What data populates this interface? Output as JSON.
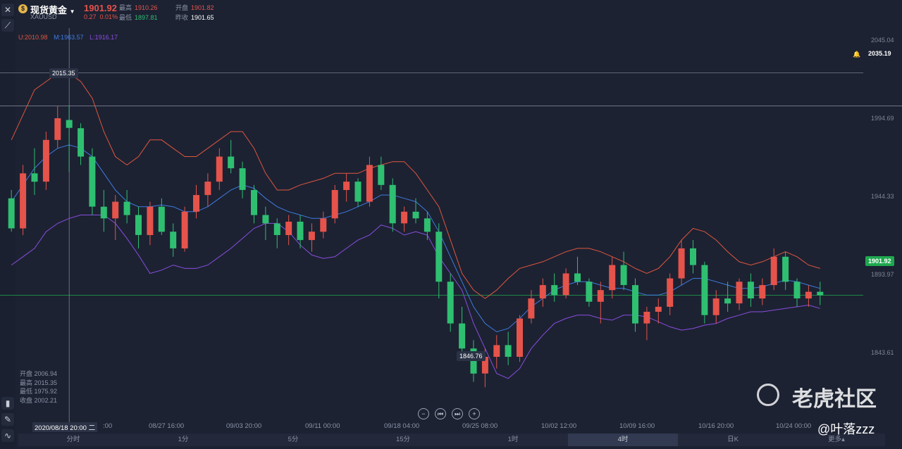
{
  "symbol": {
    "name": "现货黄金",
    "code": "XAUUSD",
    "price": "1901.92",
    "change": "0.27",
    "change_pct": "0.01%",
    "high_label": "最高",
    "high": "1910.26",
    "open_label": "开盘",
    "open": "1901.82",
    "low_label": "最低",
    "low": "1897.81",
    "prev_label": "昨收",
    "prev": "1901.65"
  },
  "boll": {
    "u": "U:2010.98",
    "m": "M:1963.57",
    "l": "L:1916.17"
  },
  "y_axis": [
    "2045.04",
    "1994.69",
    "1944.33",
    "1893.97",
    "1843.61"
  ],
  "markers": {
    "alert_price": "2035.19",
    "current_price": "1901.92",
    "peak": "2015.35",
    "trough": "1846.76"
  },
  "info": {
    "open": "开盘 2006.94",
    "high": "最高 2015.35",
    "low": "最低 1975.92",
    "close": "收盘 2002.21"
  },
  "crosshair_time": "2020/08/18 20:00 二",
  "x_axis": [
    "08/27 16:00",
    "09/03 20:00",
    "09/11 00:00",
    "09/18 04:00",
    "09/25 08:00",
    "10/02 12:00",
    "10/09 16:00",
    "10/16 20:00",
    "10/24 00:00"
  ],
  "x_axis_partial": ":00",
  "nav_buttons": [
    "−",
    "⏮",
    "⏭",
    "+"
  ],
  "periods": [
    "分时",
    "1分",
    "5分",
    "15分",
    "1时",
    "4时",
    "日K",
    "更多▴"
  ],
  "active_period": "4时",
  "watermark": "老虎社区",
  "credit": "@叶落zzz",
  "colors": {
    "up": "#e5534b",
    "down": "#2fbf71",
    "upper_band": "#e0563f",
    "mid_band": "#3f7be0",
    "lower_band": "#8a4de0",
    "current_tag": "#1fa84f"
  },
  "chart_data": {
    "type": "candlestick",
    "ylim": [
      1830,
      2062
    ],
    "candles": [
      [
        1960,
        1965,
        1940,
        1942
      ],
      [
        1942,
        1980,
        1938,
        1975
      ],
      [
        1975,
        1990,
        1962,
        1970
      ],
      [
        1970,
        2000,
        1965,
        1995
      ],
      [
        1995,
        2015.35,
        1990,
        2008
      ],
      [
        2006.94,
        2015.35,
        1975.92,
        2002.21
      ],
      [
        2002,
        2005,
        1980,
        1985
      ],
      [
        1985,
        1990,
        1950,
        1955
      ],
      [
        1955,
        1965,
        1940,
        1948
      ],
      [
        1948,
        1962,
        1935,
        1958
      ],
      [
        1958,
        1965,
        1945,
        1950
      ],
      [
        1950,
        1955,
        1930,
        1938
      ],
      [
        1938,
        1958,
        1932,
        1955
      ],
      [
        1955,
        1960,
        1938,
        1940
      ],
      [
        1940,
        1945,
        1925,
        1930
      ],
      [
        1930,
        1955,
        1928,
        1952
      ],
      [
        1952,
        1968,
        1948,
        1962
      ],
      [
        1962,
        1975,
        1955,
        1970
      ],
      [
        1970,
        1990,
        1965,
        1985
      ],
      [
        1985,
        1995,
        1975,
        1978
      ],
      [
        1978,
        1982,
        1960,
        1965
      ],
      [
        1965,
        1968,
        1945,
        1950
      ],
      [
        1950,
        1955,
        1935,
        1945
      ],
      [
        1945,
        1948,
        1930,
        1938
      ],
      [
        1938,
        1950,
        1932,
        1946
      ],
      [
        1946,
        1950,
        1930,
        1935
      ],
      [
        1935,
        1945,
        1928,
        1940
      ],
      [
        1940,
        1952,
        1936,
        1948
      ],
      [
        1948,
        1968,
        1945,
        1965
      ],
      [
        1965,
        1975,
        1958,
        1970
      ],
      [
        1970,
        1972,
        1955,
        1958
      ],
      [
        1958,
        1985,
        1955,
        1980
      ],
      [
        1980,
        1985,
        1965,
        1968
      ],
      [
        1968,
        1972,
        1940,
        1945
      ],
      [
        1945,
        1955,
        1940,
        1952
      ],
      [
        1952,
        1960,
        1945,
        1948
      ],
      [
        1948,
        1952,
        1935,
        1940
      ],
      [
        1940,
        1945,
        1900,
        1910
      ],
      [
        1910,
        1915,
        1880,
        1885
      ],
      [
        1885,
        1895,
        1865,
        1870
      ],
      [
        1870,
        1875,
        1850,
        1855
      ],
      [
        1855,
        1870,
        1846.76,
        1865
      ],
      [
        1865,
        1878,
        1858,
        1872
      ],
      [
        1872,
        1880,
        1860,
        1865
      ],
      [
        1865,
        1890,
        1862,
        1888
      ],
      [
        1888,
        1905,
        1885,
        1900
      ],
      [
        1900,
        1912,
        1895,
        1908
      ],
      [
        1908,
        1915,
        1898,
        1902
      ],
      [
        1902,
        1918,
        1900,
        1915
      ],
      [
        1915,
        1925,
        1908,
        1910
      ],
      [
        1910,
        1912,
        1895,
        1898
      ],
      [
        1898,
        1910,
        1885,
        1905
      ],
      [
        1905,
        1925,
        1900,
        1920
      ],
      [
        1920,
        1928,
        1905,
        1908
      ],
      [
        1908,
        1912,
        1880,
        1885
      ],
      [
        1885,
        1895,
        1875,
        1892
      ],
      [
        1892,
        1900,
        1885,
        1895
      ],
      [
        1895,
        1915,
        1890,
        1912
      ],
      [
        1912,
        1935,
        1908,
        1930
      ],
      [
        1930,
        1935,
        1915,
        1920
      ],
      [
        1920,
        1922,
        1885,
        1890
      ],
      [
        1890,
        1905,
        1885,
        1900
      ],
      [
        1900,
        1910,
        1892,
        1897
      ],
      [
        1897,
        1912,
        1893,
        1910
      ],
      [
        1910,
        1915,
        1895,
        1900
      ],
      [
        1900,
        1912,
        1896,
        1908
      ],
      [
        1908,
        1930,
        1905,
        1925
      ],
      [
        1925,
        1928,
        1905,
        1910
      ],
      [
        1910,
        1912,
        1895,
        1900
      ],
      [
        1900,
        1908,
        1895,
        1904
      ],
      [
        1904,
        1910,
        1896,
        1901.92
      ]
    ],
    "bands": {
      "upper": [
        1995,
        2010,
        2025,
        2030,
        2035,
        2035,
        2030,
        2020,
        2000,
        1985,
        1980,
        1985,
        1995,
        1995,
        1990,
        1985,
        1985,
        1990,
        1995,
        2000,
        2000,
        1990,
        1975,
        1965,
        1965,
        1968,
        1970,
        1972,
        1975,
        1975,
        1975,
        1978,
        1980,
        1982,
        1982,
        1975,
        1965,
        1955,
        1935,
        1915,
        1905,
        1900,
        1905,
        1912,
        1918,
        1920,
        1922,
        1925,
        1928,
        1930,
        1930,
        1928,
        1925,
        1922,
        1918,
        1915,
        1918,
        1925,
        1935,
        1942,
        1940,
        1935,
        1928,
        1922,
        1920,
        1922,
        1925,
        1928,
        1925,
        1920,
        1918
      ],
      "mid": [
        1958,
        1968,
        1978,
        1985,
        1990,
        1992,
        1990,
        1985,
        1975,
        1965,
        1958,
        1955,
        1955,
        1956,
        1955,
        1952,
        1952,
        1955,
        1960,
        1965,
        1968,
        1966,
        1960,
        1955,
        1952,
        1950,
        1948,
        1948,
        1950,
        1952,
        1955,
        1958,
        1962,
        1962,
        1960,
        1958,
        1952,
        1940,
        1925,
        1910,
        1895,
        1885,
        1880,
        1882,
        1888,
        1895,
        1900,
        1905,
        1908,
        1910,
        1910,
        1908,
        1906,
        1906,
        1904,
        1902,
        1902,
        1904,
        1908,
        1912,
        1912,
        1910,
        1908,
        1906,
        1906,
        1907,
        1909,
        1911,
        1910,
        1908,
        1906
      ],
      "lower": [
        1920,
        1925,
        1930,
        1940,
        1945,
        1948,
        1950,
        1950,
        1950,
        1945,
        1936,
        1926,
        1915,
        1917,
        1920,
        1918,
        1918,
        1920,
        1925,
        1930,
        1936,
        1942,
        1945,
        1945,
        1940,
        1932,
        1926,
        1924,
        1925,
        1930,
        1935,
        1938,
        1944,
        1942,
        1938,
        1940,
        1938,
        1925,
        1915,
        1905,
        1885,
        1870,
        1855,
        1852,
        1858,
        1870,
        1878,
        1885,
        1888,
        1890,
        1890,
        1888,
        1887,
        1890,
        1890,
        1889,
        1886,
        1883,
        1881,
        1882,
        1884,
        1885,
        1888,
        1890,
        1892,
        1892,
        1893,
        1894,
        1895,
        1896,
        1894
      ]
    }
  }
}
